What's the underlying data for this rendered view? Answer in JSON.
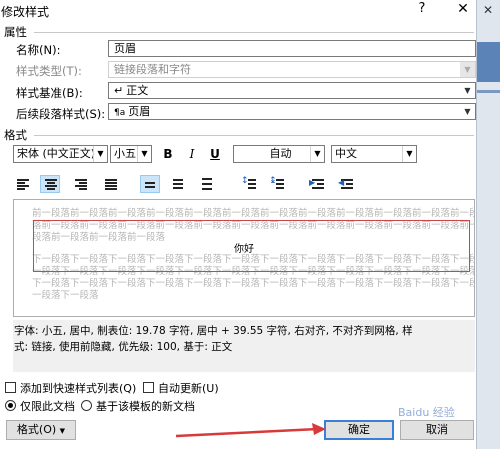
{
  "window": {
    "title": "修改样式",
    "help_glyph": "?",
    "close_glyph": "✕"
  },
  "behind": {
    "close_glyph": "✕"
  },
  "properties": {
    "heading": "属性",
    "name": {
      "label": "名称(N):",
      "value": "页眉"
    },
    "style_type": {
      "label": "样式类型(T):",
      "value": "链接段落和字符"
    },
    "based_on": {
      "label": "样式基准(B):",
      "value": "正文",
      "icon": "paragraph-mark-icon"
    },
    "next_style": {
      "label": "后续段落样式(S):",
      "value": "页眉",
      "icon": "style-icon"
    }
  },
  "format": {
    "heading": "格式",
    "font": "宋体 (中文正文)",
    "size": "小五",
    "bold": "B",
    "italic": "I",
    "underline": "U",
    "color": "自动",
    "script": "中文"
  },
  "preview": {
    "prev_line1": "前一段落前一段落前一段落前一段落前一段落前一段落前一段落前一段落前一段落前一段落前一段落前一段落",
    "prev_line2": "落前一段落前一段落前一段落前一段落前一段落前一段落前一段落前一段落前一段落前一段落前一段落前一段落前一段",
    "prev_line3": "段落前一段落前一段落前一段落",
    "sample": "你好",
    "next_line1": "下一段落下一段落下一段落下一段落下一段落下一段落下一段落下一段落下一段落下一段落下一段落下一段落下",
    "next_line2": "一段落下一段落下一段落下一段落下一段落下一段落下一段落下一段落下一段落下一段落下一段落下一段落下一段落",
    "next_line3": "下一段落下一段落下一段落下一段落下一段落下一段落下一段落下一段落下一段落下一段落下一段落下一段落下",
    "next_line4": "一段落下一段落"
  },
  "description": {
    "line1": "字体: 小五, 居中, 制表位:  19.78 字符, 居中 +  39.55 字符, 右对齐, 不对齐到网格, 样",
    "line2": "式: 链接, 使用前隐藏, 优先级: 100, 基于: 正文"
  },
  "options": {
    "add_to_gallery": {
      "label": "添加到快速样式列表(Q)",
      "checked": false
    },
    "auto_update": {
      "label": "自动更新(U)",
      "checked": false
    },
    "this_doc_only": {
      "label": "仅限此文档",
      "selected": true
    },
    "new_docs": {
      "label": "基于该模板的新文档",
      "selected": false
    }
  },
  "buttons": {
    "format": "格式(O)",
    "ok": "确定",
    "cancel": "取消"
  },
  "watermark": "Baidu 经验",
  "colors": {
    "highlight": "#cce4f7",
    "annotation_red": "#c84848",
    "ok_border": "#3c7fd8"
  }
}
